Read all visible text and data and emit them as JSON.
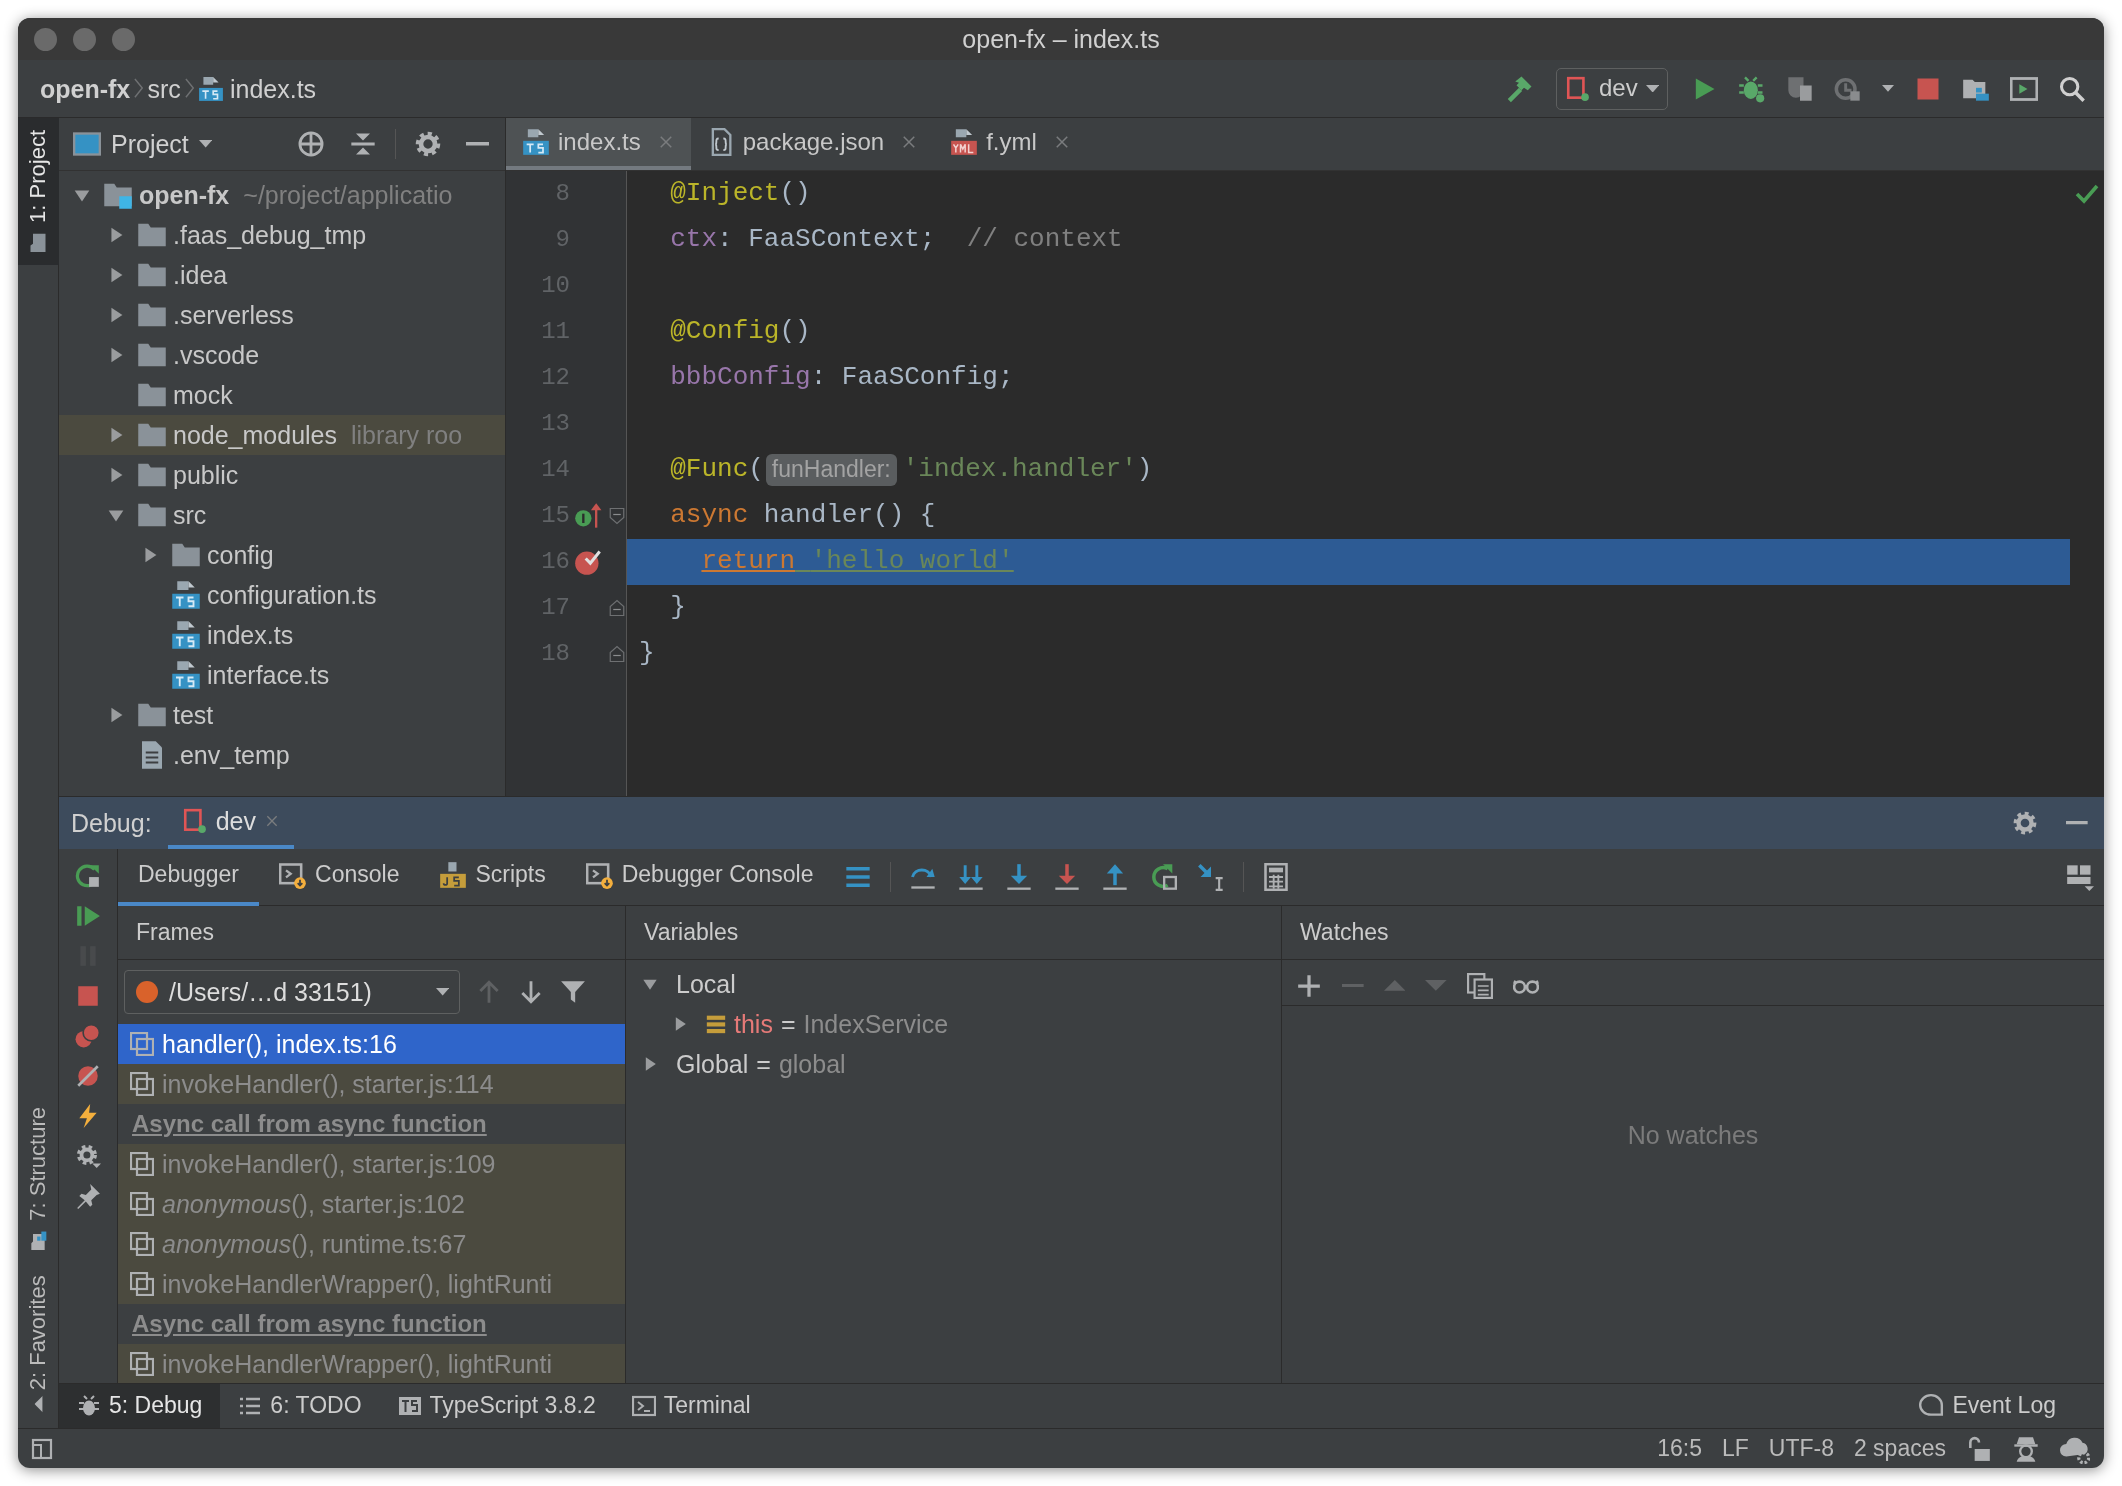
{
  "window": {
    "title": "open-fx – index.ts"
  },
  "navigation": {
    "breadcrumbs": [
      {
        "label": "open-fx",
        "kind": "project"
      },
      {
        "label": "src",
        "kind": "folder"
      },
      {
        "label": "index.ts",
        "kind": "ts"
      }
    ],
    "run_configuration": "dev"
  },
  "left_stripe": {
    "top": [
      {
        "label": "1: Project",
        "kind": "project",
        "selected": true
      }
    ],
    "bottom": [
      {
        "label": "7: Structure",
        "kind": "structure",
        "selected": false
      },
      {
        "label": "2: Favorites",
        "kind": "favorites",
        "selected": false
      }
    ]
  },
  "project_panel": {
    "title": "Project",
    "tree": [
      {
        "label": "open-fx",
        "hint": "~/project/applicatio",
        "kind": "project",
        "expanded": true,
        "children": [
          {
            "label": ".faas_debug_tmp",
            "kind": "folder",
            "expanded": false
          },
          {
            "label": ".idea",
            "kind": "folder",
            "expanded": false
          },
          {
            "label": ".serverless",
            "kind": "folder",
            "expanded": false
          },
          {
            "label": ".vscode",
            "kind": "folder",
            "expanded": false
          },
          {
            "label": "mock",
            "kind": "folder"
          },
          {
            "label": "node_modules",
            "hint": "library roo",
            "kind": "library",
            "expanded": false
          },
          {
            "label": "public",
            "kind": "folder",
            "expanded": false
          },
          {
            "label": "src",
            "kind": "folder",
            "expanded": true,
            "children": [
              {
                "label": "config",
                "kind": "folder",
                "expanded": false
              },
              {
                "label": "configuration.ts",
                "kind": "ts"
              },
              {
                "label": "index.ts",
                "kind": "ts"
              },
              {
                "label": "interface.ts",
                "kind": "ts"
              }
            ]
          },
          {
            "label": "test",
            "kind": "folder",
            "expanded": false
          },
          {
            "label": ".env_temp",
            "kind": "text"
          }
        ]
      }
    ]
  },
  "editor": {
    "tabs": [
      {
        "label": "index.ts",
        "kind": "ts",
        "selected": true
      },
      {
        "label": "package.json",
        "kind": "json",
        "selected": false
      },
      {
        "label": "f.yml",
        "kind": "yml",
        "selected": false
      }
    ],
    "lines": [
      {
        "number": "8",
        "current": false,
        "tokens": [
          {
            "kind": "decorator",
            "text": "  @Inject"
          },
          {
            "kind": "plain",
            "text": "()"
          }
        ]
      },
      {
        "number": "9",
        "current": false,
        "tokens": [
          {
            "kind": "field",
            "text": "  ctx"
          },
          {
            "kind": "plain",
            "text": ": FaaSContext;  "
          },
          {
            "kind": "comment",
            "text": "// context"
          }
        ]
      },
      {
        "number": "10",
        "current": false
      },
      {
        "number": "11",
        "current": false,
        "tokens": [
          {
            "kind": "decorator",
            "text": "  @Config"
          },
          {
            "kind": "plain",
            "text": "()"
          }
        ]
      },
      {
        "number": "12",
        "current": false,
        "tokens": [
          {
            "kind": "field",
            "text": "  bbbConfig"
          },
          {
            "kind": "plain",
            "text": ": FaaSConfig;"
          }
        ]
      },
      {
        "number": "13",
        "current": false
      },
      {
        "number": "14",
        "current": false,
        "tokens": [
          {
            "kind": "decorator",
            "text": "  @Func"
          },
          {
            "kind": "plain",
            "text": "("
          },
          {
            "kind": "hint",
            "text": "funHandler:"
          },
          {
            "kind": "string",
            "text": "'index.handler'"
          },
          {
            "kind": "plain",
            "text": ")"
          }
        ]
      },
      {
        "number": "15",
        "current": false,
        "markers": [
          {
            "kind": "implements"
          },
          {
            "kind": "fold-start"
          }
        ],
        "tokens": [
          {
            "kind": "keyword",
            "text": "  async"
          },
          {
            "kind": "plain",
            "text": " handler() {"
          }
        ]
      },
      {
        "number": "16",
        "current": true,
        "markers": [
          {
            "kind": "breakpoint"
          }
        ],
        "tokens": [
          {
            "kind": "keyword",
            "text": "    return"
          },
          {
            "kind": "string",
            "text": " 'hello world'"
          }
        ]
      },
      {
        "number": "17",
        "current": false,
        "markers": [
          {
            "kind": "fold-end"
          }
        ],
        "tokens": [
          {
            "kind": "plain",
            "text": "  }"
          }
        ]
      },
      {
        "number": "18",
        "current": false,
        "markers": [
          {
            "kind": "fold-end"
          }
        ],
        "tokens": [
          {
            "kind": "plain",
            "text": "}"
          }
        ]
      }
    ]
  },
  "debug": {
    "title": "Debug:",
    "session": "dev",
    "side_toolbar": [
      {
        "kind": "rerun",
        "disabled": false
      },
      {
        "kind": "resume",
        "disabled": false
      },
      {
        "kind": "pause",
        "disabled": true
      },
      {
        "kind": "stop",
        "disabled": false
      },
      {
        "kind": "breakpoints",
        "disabled": false
      },
      {
        "kind": "mute",
        "disabled": false
      },
      {
        "kind": "lightning",
        "disabled": false
      },
      {
        "kind": "settings",
        "disabled": false
      },
      {
        "kind": "pin",
        "disabled": false
      }
    ],
    "tabs": [
      {
        "label": "Debugger",
        "kind": "debugger",
        "selected": true
      },
      {
        "label": "Console",
        "kind": "console",
        "selected": false
      },
      {
        "label": "Scripts",
        "kind": "scripts",
        "selected": false
      },
      {
        "label": "Debugger Console",
        "kind": "console",
        "selected": false
      }
    ],
    "frames": {
      "title": "Frames",
      "thread": "/Users/…d 33151)",
      "toolbar": [
        {
          "kind": "up",
          "disabled": true
        },
        {
          "kind": "down",
          "disabled": false
        },
        {
          "kind": "filter",
          "disabled": false
        }
      ],
      "items": [
        {
          "kind": "frame",
          "text": "handler(), index.ts:16",
          "selected": true
        },
        {
          "kind": "frame",
          "text": "invokeHandler(), starter.js:114",
          "selected": false
        },
        {
          "kind": "async",
          "text": "Async call from async function"
        },
        {
          "kind": "frame",
          "text": "invokeHandler(), starter.js:109",
          "selected": false
        },
        {
          "kind": "frame",
          "text": "*anonymous*(), starter.js:102",
          "selected": false
        },
        {
          "kind": "frame",
          "text": "*anonymous*(), runtime.ts:67",
          "selected": false
        },
        {
          "kind": "frame",
          "text": "invokeHandlerWrapper(), lightRunti",
          "selected": false
        },
        {
          "kind": "async",
          "text": "Async call from async function"
        },
        {
          "kind": "frame",
          "text": "invokeHandlerWrapper(), lightRunti",
          "selected": false
        }
      ]
    },
    "variables": {
      "title": "Variables",
      "tree": [
        {
          "name": "Local",
          "expanded": true,
          "children": [
            {
              "name": "this",
              "operator": "=",
              "value": "IndexService",
              "kind": "object",
              "expanded": false
            }
          ]
        },
        {
          "name": "Global",
          "operator": "=",
          "value": "global",
          "expanded": false
        }
      ]
    },
    "watches": {
      "title": "Watches",
      "toolbar": [
        {
          "kind": "add",
          "disabled": false
        },
        {
          "kind": "remove",
          "disabled": true
        },
        {
          "kind": "up",
          "disabled": true
        },
        {
          "kind": "down",
          "disabled": true
        },
        {
          "kind": "copy",
          "disabled": false
        },
        {
          "kind": "glasses",
          "disabled": false
        }
      ],
      "empty_text": "No watches"
    }
  },
  "bottom_bar": {
    "tools": [
      {
        "label": "5: Debug",
        "kind": "debug",
        "selected": true
      },
      {
        "label": "6: TODO",
        "kind": "todo",
        "selected": false
      },
      {
        "label": "TypeScript 3.8.2",
        "kind": "typescript",
        "selected": false
      },
      {
        "label": "Terminal",
        "kind": "terminal",
        "selected": false
      }
    ],
    "event_log": "Event Log"
  },
  "status_bar": {
    "items": [
      "16:5",
      "LF",
      "UTF-8",
      "2 spaces"
    ]
  }
}
